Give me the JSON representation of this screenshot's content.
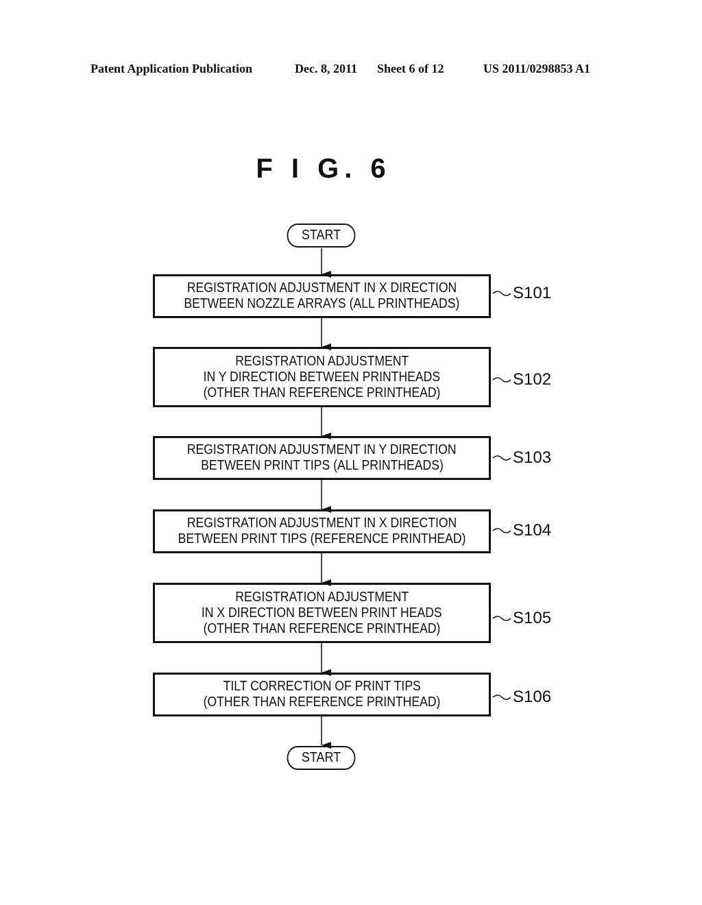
{
  "header": {
    "publication": "Patent Application Publication",
    "date": "Dec. 8, 2011",
    "sheet": "Sheet 6 of 12",
    "patent_number": "US 2011/0298853 A1"
  },
  "figure": {
    "title": "F I G.  6"
  },
  "flowchart": {
    "start_label": "START",
    "end_label": "START",
    "steps": [
      {
        "id": "S101",
        "lines": [
          "REGISTRATION ADJUSTMENT IN X DIRECTION",
          "BETWEEN NOZZLE ARRAYS (ALL PRINTHEADS)"
        ]
      },
      {
        "id": "S102",
        "lines": [
          "REGISTRATION ADJUSTMENT",
          "IN Y DIRECTION BETWEEN PRINTHEADS",
          "(OTHER THAN REFERENCE PRINTHEAD)"
        ]
      },
      {
        "id": "S103",
        "lines": [
          "REGISTRATION ADJUSTMENT IN Y DIRECTION",
          "BETWEEN PRINT TIPS (ALL PRINTHEADS)"
        ]
      },
      {
        "id": "S104",
        "lines": [
          "REGISTRATION ADJUSTMENT IN X DIRECTION",
          "BETWEEN PRINT TIPS (REFERENCE PRINTHEAD)"
        ]
      },
      {
        "id": "S105",
        "lines": [
          "REGISTRATION ADJUSTMENT",
          "IN X DIRECTION BETWEEN PRINT HEADS",
          "(OTHER THAN REFERENCE PRINTHEAD)"
        ]
      },
      {
        "id": "S106",
        "lines": [
          "TILT CORRECTION OF PRINT TIPS",
          "(OTHER THAN REFERENCE PRINTHEAD)"
        ]
      }
    ]
  }
}
